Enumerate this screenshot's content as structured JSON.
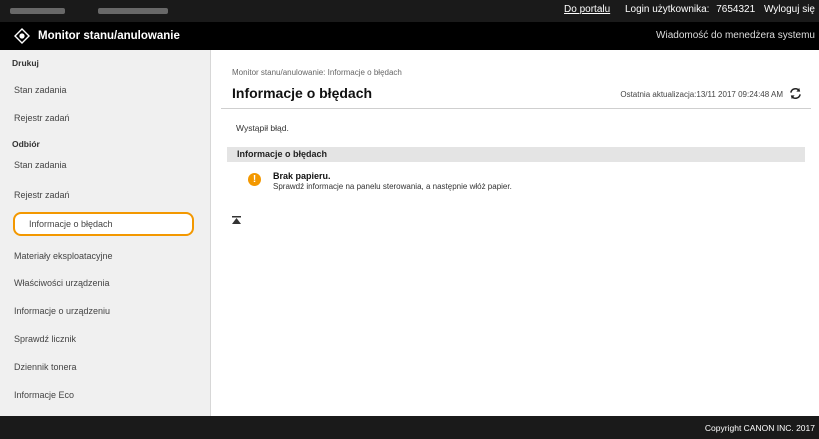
{
  "topbar": {
    "portal_link": "Do portalu",
    "login_label": "Login użytkownika:",
    "login_value": "7654321",
    "logout_link": "Wyloguj się"
  },
  "header": {
    "app_title": "Monitor stanu/anulowanie",
    "message_link": "Wiadomość do menedżera systemu"
  },
  "sidebar": {
    "print_header": "Drukuj",
    "print_items": [
      "Stan zadania",
      "Rejestr zadań"
    ],
    "receive_header": "Odbiór",
    "receive_items": [
      "Stan zadania",
      "Rejestr zadań"
    ],
    "items": [
      "Informacje o błędach",
      "Materiały eksploatacyjne",
      "Właściwości urządzenia",
      "Informacje o urządzeniu",
      "Sprawdź licznik",
      "Dziennik tonera",
      "Informacje Eco"
    ],
    "accent_color": "#f39800"
  },
  "main": {
    "breadcrumb": "Monitor stanu/anulowanie: Informacje o błędach",
    "title": "Informacje o błędach",
    "last_update": "Ostatnia aktualizacja:13/11 2017 09:24:48 AM",
    "status_text": "Wystąpił błąd.",
    "section_header": "Informacje o błędach",
    "error": {
      "icon": "!",
      "title": "Brak papieru.",
      "description": "Sprawdź informacje na panelu sterowania, a następnie włóż papier."
    }
  },
  "footer": {
    "copyright": "Copyright CANON INC. 2017"
  }
}
